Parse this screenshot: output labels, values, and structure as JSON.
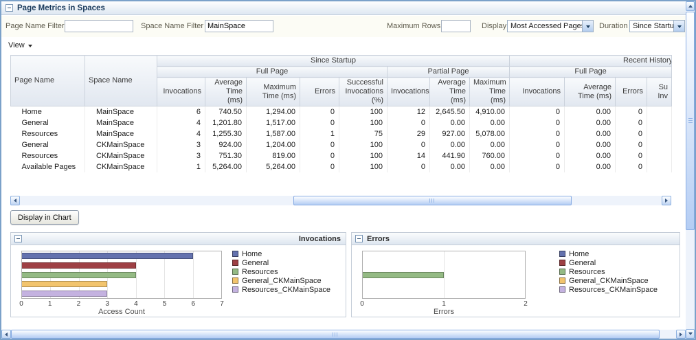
{
  "panel": {
    "title": "Page Metrics in Spaces"
  },
  "filters": {
    "page_name": {
      "label": "Page Name Filter",
      "value": ""
    },
    "space_name": {
      "label": "Space Name Filter",
      "value": "MainSpace"
    },
    "max_rows": {
      "label": "Maximum Rows",
      "value": ""
    },
    "display": {
      "label": "Display",
      "value": "Most Accessed Pages"
    },
    "duration": {
      "label": "Duration",
      "value": "Since Startup"
    }
  },
  "toolbar": {
    "view_label": "View"
  },
  "table": {
    "row_header_columns": [
      "Page Name",
      "Space Name"
    ],
    "groups": [
      {
        "label": "Since Startup",
        "subgroups": [
          {
            "label": "Full Page",
            "columns": [
              "Invocations",
              "Average Time (ms)",
              "Maximum Time (ms)",
              "Errors",
              "Successful Invocations (%)"
            ]
          },
          {
            "label": "Partial Page",
            "columns": [
              "Invocations",
              "Average Time (ms)",
              "Maximum Time (ms)"
            ]
          }
        ]
      },
      {
        "label": "Recent History",
        "subgroups": [
          {
            "label": "Full Page",
            "columns": [
              "Invocations",
              "Average Time (ms)",
              "Errors",
              "Su\nInv"
            ]
          }
        ]
      }
    ],
    "rows": [
      [
        "Home",
        "MainSpace",
        "6",
        "740.50",
        "1,294.00",
        "0",
        "100",
        "12",
        "2,645.50",
        "4,910.00",
        "0",
        "0.00",
        "0",
        ""
      ],
      [
        "General",
        "MainSpace",
        "4",
        "1,201.80",
        "1,517.00",
        "0",
        "100",
        "0",
        "0.00",
        "0.00",
        "0",
        "0.00",
        "0",
        ""
      ],
      [
        "Resources",
        "MainSpace",
        "4",
        "1,255.30",
        "1,587.00",
        "1",
        "75",
        "29",
        "927.00",
        "5,078.00",
        "0",
        "0.00",
        "0",
        ""
      ],
      [
        "General",
        "CKMainSpace",
        "3",
        "924.00",
        "1,204.00",
        "0",
        "100",
        "0",
        "0.00",
        "0.00",
        "0",
        "0.00",
        "0",
        ""
      ],
      [
        "Resources",
        "CKMainSpace",
        "3",
        "751.30",
        "819.00",
        "0",
        "100",
        "14",
        "441.90",
        "760.00",
        "0",
        "0.00",
        "0",
        ""
      ],
      [
        "Available Pages",
        "CKMainSpace",
        "1",
        "5,264.00",
        "5,264.00",
        "0",
        "100",
        "0",
        "0.00",
        "0.00",
        "0",
        "0.00",
        "0",
        ""
      ]
    ]
  },
  "actions": {
    "display_in_chart": "Display in Chart"
  },
  "chart_data": [
    {
      "type": "bar",
      "orientation": "horizontal",
      "title": "Invocations",
      "xlabel": "Access Count",
      "xlim": [
        0,
        7
      ],
      "xticks": [
        0,
        1,
        2,
        3,
        4,
        5,
        6,
        7
      ],
      "categories": [
        "Home",
        "General",
        "Resources",
        "General_CKMainSpace",
        "Resources_CKMainSpace"
      ],
      "values": [
        6,
        4,
        4,
        3,
        3
      ],
      "colors": [
        "#6472ae",
        "#9e4044",
        "#94ba84",
        "#f2c46d",
        "#c4b2e0"
      ],
      "legend": [
        "Home",
        "General",
        "Resources",
        "General_CKMainSpace",
        "Resources_CKMainSpace"
      ],
      "legend_position": "right",
      "grid": true
    },
    {
      "type": "bar",
      "orientation": "horizontal",
      "title": "Errors",
      "xlabel": "Errors",
      "xlim": [
        0,
        2
      ],
      "xticks": [
        0,
        1,
        2
      ],
      "categories": [
        "Home",
        "General",
        "Resources",
        "General_CKMainSpace",
        "Resources_CKMainSpace"
      ],
      "values": [
        0,
        0,
        1,
        0,
        0
      ],
      "colors": [
        "#6472ae",
        "#9e4044",
        "#94ba84",
        "#f2c46d",
        "#c4b2e0"
      ],
      "legend": [
        "Home",
        "General",
        "Resources",
        "General_CKMainSpace",
        "Resources_CKMainSpace"
      ],
      "legend_position": "right",
      "grid": true
    }
  ]
}
